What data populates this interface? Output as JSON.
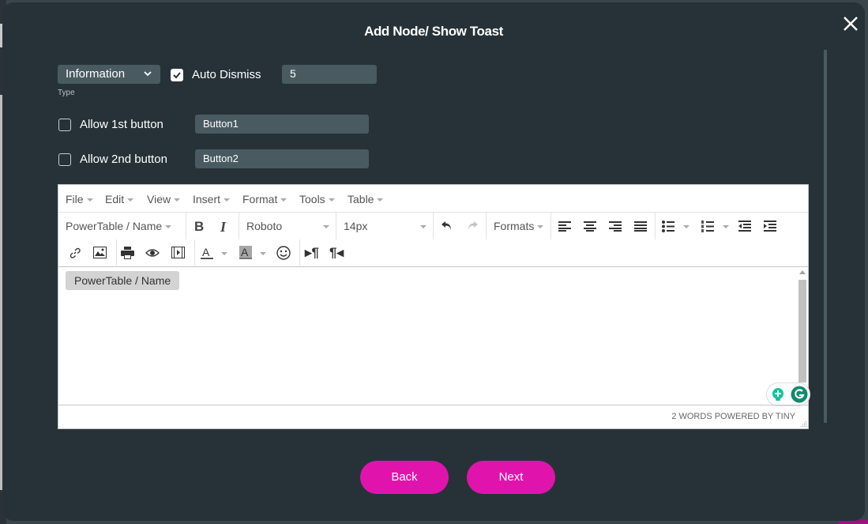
{
  "dialog": {
    "title": "Add Node/ Show Toast",
    "close_icon": "close-icon"
  },
  "type_select": {
    "value": "Information",
    "label": "Type"
  },
  "auto_dismiss": {
    "label": "Auto Dismiss",
    "checked": true,
    "value": "5"
  },
  "button1": {
    "label": "Allow 1st button",
    "checked": false,
    "value": "Button1"
  },
  "button2": {
    "label": "Allow 2nd button",
    "checked": false,
    "value": "Button2"
  },
  "editor": {
    "menus": [
      "File",
      "Edit",
      "View",
      "Insert",
      "Format",
      "Tools",
      "Table"
    ],
    "toolbar": {
      "block_format": "PowerTable / Name",
      "font_family": "Roboto",
      "font_size": "14px",
      "formats": "Formats"
    },
    "content_tag": "PowerTable / Name",
    "status": "2 WORDS POWERED BY TINY"
  },
  "footer": {
    "back_label": "Back",
    "next_label": "Next"
  },
  "colors": {
    "modal_bg": "#273238",
    "field_bg": "#4a5a61",
    "accent": "#e014ad",
    "grammarly": "#15c39a"
  }
}
